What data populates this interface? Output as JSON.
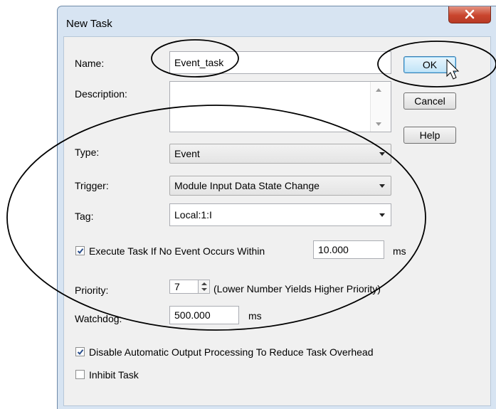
{
  "dialog": {
    "title": "New Task",
    "close_icon": "close-icon"
  },
  "form": {
    "name_label": "Name:",
    "name_value": "Event_task",
    "description_label": "Description:",
    "description_value": "",
    "type_label": "Type:",
    "type_value": "Event",
    "trigger_label": "Trigger:",
    "trigger_value": "Module Input Data State Change",
    "tag_label": "Tag:",
    "tag_value": "Local:1:I",
    "execute_checked": true,
    "execute_label": "Execute Task If No Event Occurs Within",
    "execute_value": "10.000",
    "execute_unit": "ms",
    "priority_label": "Priority:",
    "priority_value": "7",
    "priority_hint": "(Lower Number Yields Higher Priority)",
    "watchdog_label": "Watchdog:",
    "watchdog_value": "500.000",
    "watchdog_unit": "ms",
    "disable_checked": true,
    "disable_label": "Disable Automatic Output Processing To Reduce Task Overhead",
    "inhibit_checked": false,
    "inhibit_label": "Inhibit Task"
  },
  "buttons": {
    "ok": "OK",
    "cancel": "Cancel",
    "help": "Help"
  },
  "colors": {
    "frame": "#d7e4f2",
    "client": "#f0f0f0",
    "close": "#c9452e"
  }
}
